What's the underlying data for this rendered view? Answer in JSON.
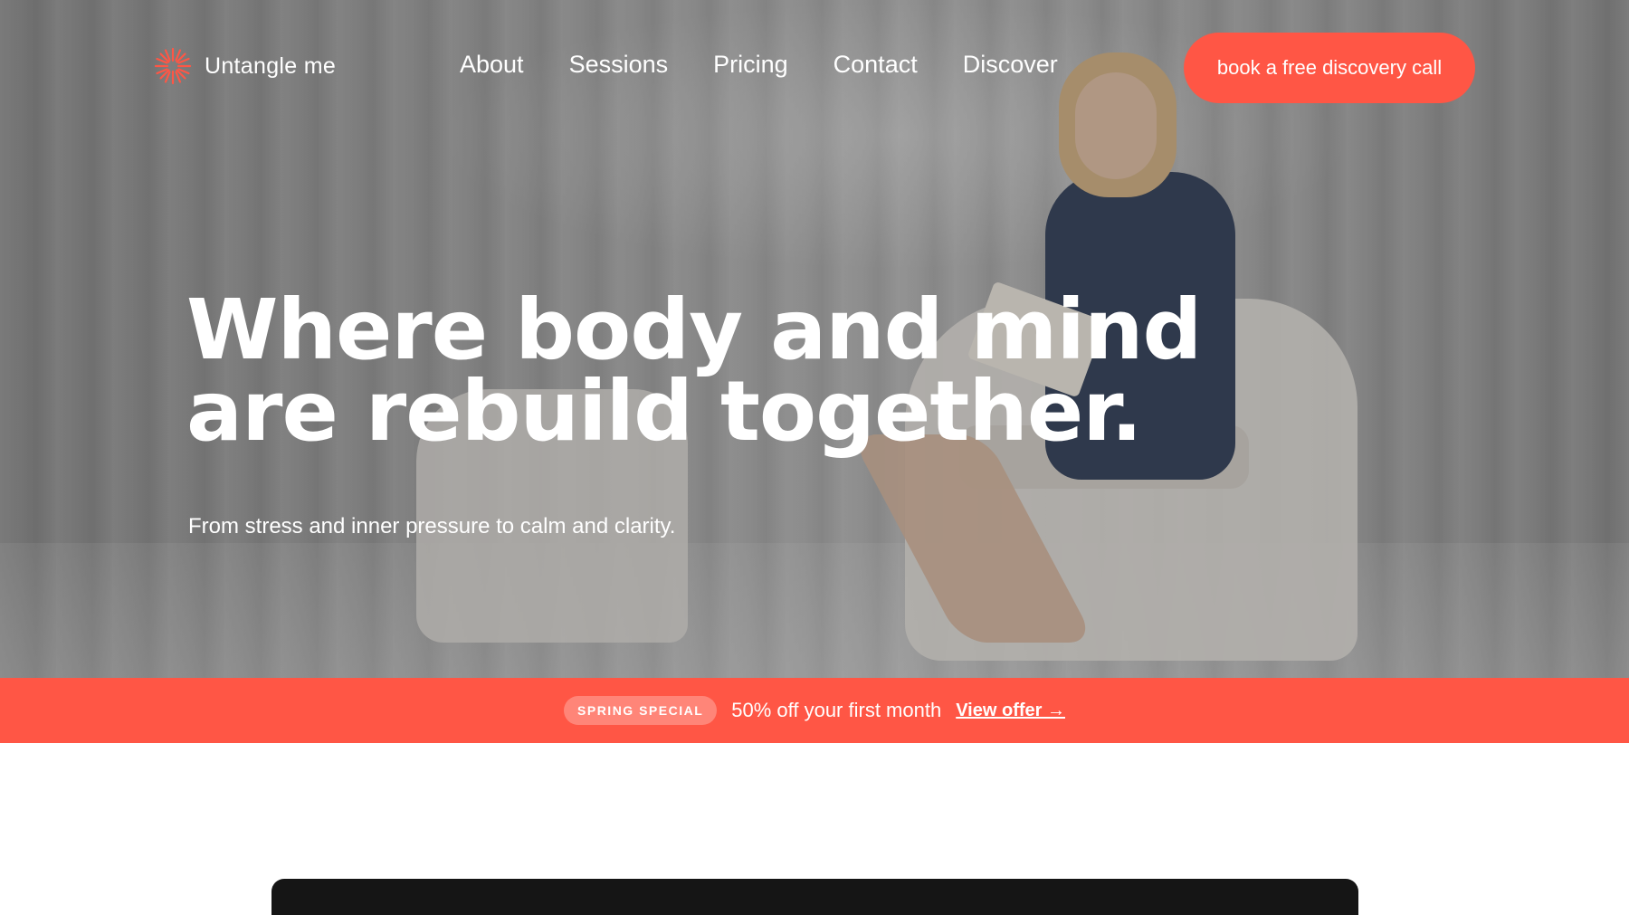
{
  "brand": {
    "name": "Untangle me",
    "logo_icon": "sunburst-icon",
    "accent": "#ff5645"
  },
  "nav": {
    "links": [
      "About",
      "Sessions",
      "Pricing",
      "Contact",
      "Discover"
    ],
    "cta_label": "book a free discovery call"
  },
  "hero": {
    "headline_line1": "Where body and mind",
    "headline_line2": "are rebuild together.",
    "subheadline": "From stress and inner pressure to calm and clarity."
  },
  "promo": {
    "badge": "SPRING SPECIAL",
    "text": "50% off your first month",
    "link": "View offer →"
  }
}
